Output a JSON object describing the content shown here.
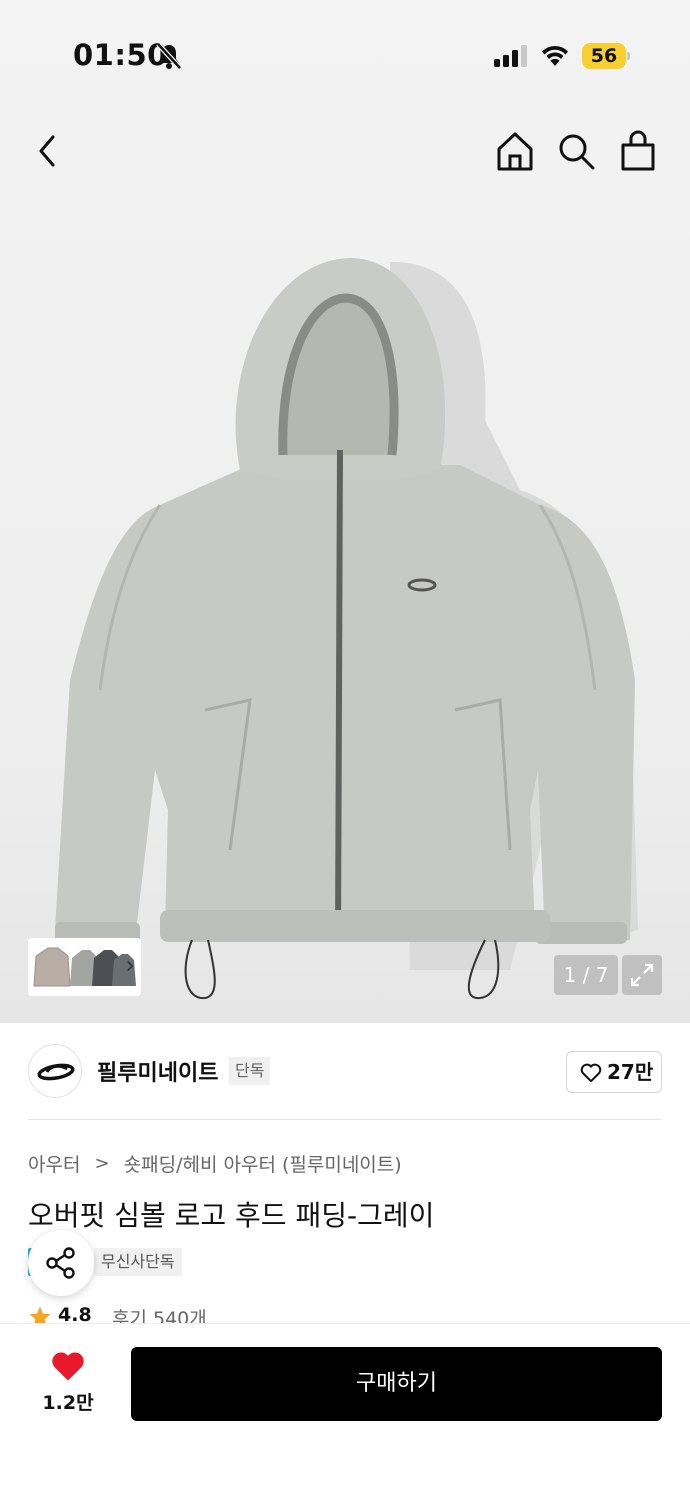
{
  "status_bar": {
    "time": "01:50",
    "battery": "56"
  },
  "colors": {
    "accent_heart": "#e8192c",
    "star": "#f5a623",
    "tag_blue": "#16b1f0",
    "buy_button": "#000000"
  },
  "gallery": {
    "counter": "1 / 7",
    "thumb_arrow": "›"
  },
  "brand": {
    "name": "필루미네이트",
    "badge": "단독",
    "like_count": "27만"
  },
  "breadcrumb": {
    "level1": "아우터",
    "separator": ">",
    "level2": "숏패딩/헤비 아우터 (필루미네이트)"
  },
  "product": {
    "title": "오버핏 심볼 로고 후드 패딩-그레이",
    "tag": "무신사단독"
  },
  "rating": {
    "score": "4.8",
    "reviews": "후기 540개"
  },
  "bottom_bar": {
    "wish_count": "1.2만",
    "buy_label": "구매하기"
  },
  "icons": [
    "bell-off-icon",
    "signal-icon",
    "wifi-icon",
    "back-icon",
    "home-icon",
    "search-icon",
    "bag-icon",
    "expand-icon",
    "heart-outline-icon",
    "share-icon",
    "star-icon",
    "heart-filled-icon"
  ]
}
